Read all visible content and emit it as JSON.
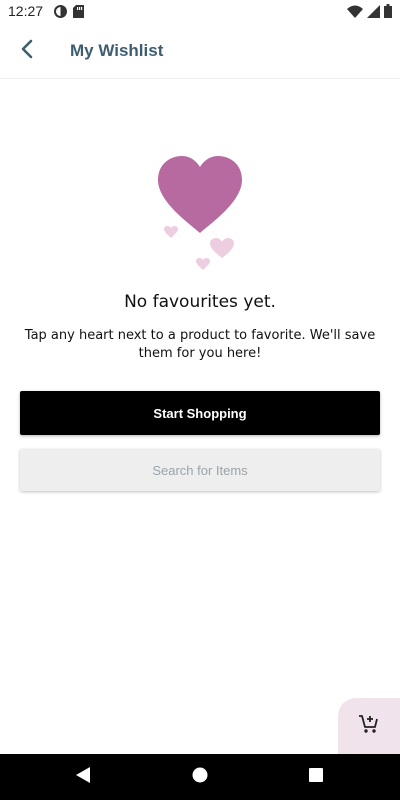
{
  "status_bar": {
    "time": "12:27",
    "left_icons": [
      "alarm-icon",
      "sd-card-icon"
    ],
    "right_icons": [
      "wifi-icon",
      "signal-icon",
      "battery-icon"
    ]
  },
  "header": {
    "title": "My Wishlist",
    "back_icon": "back-arrow-icon"
  },
  "empty_state": {
    "illustration": "hearts-icon",
    "title": "No favourites yet.",
    "description": "Tap any heart next to a product to favorite. We'll save them for you here!"
  },
  "buttons": {
    "primary_label": "Start Shopping",
    "secondary_label": "Search for Items"
  },
  "cart_fab": {
    "icon": "cart-add-icon"
  },
  "nav_bar": {
    "icons": [
      "nav-back-icon",
      "nav-home-icon",
      "nav-recents-icon"
    ]
  },
  "colors": {
    "accent_heart": "#b66aa0",
    "light_heart": "#edcde0",
    "title": "#3e5e70",
    "primary_button": "#000000",
    "secondary_button": "#eeeeee",
    "fab_background": "#f1e3ec"
  }
}
